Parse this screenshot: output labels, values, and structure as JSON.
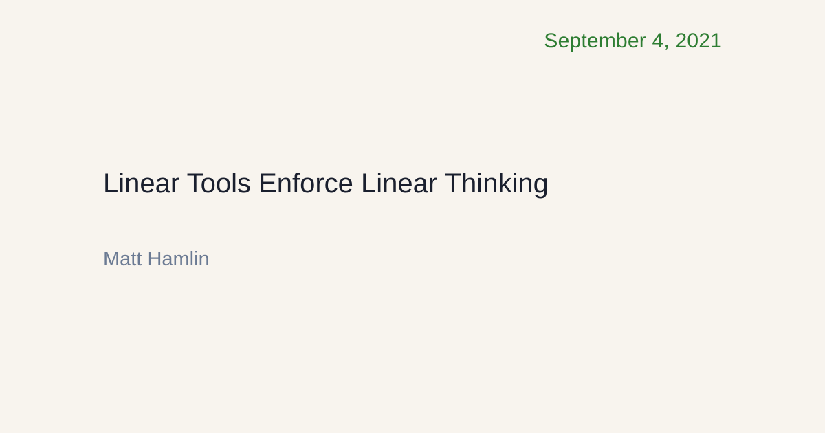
{
  "post": {
    "date": "September 4, 2021",
    "title": "Linear Tools Enforce Linear Thinking",
    "author": "Matt Hamlin"
  },
  "colors": {
    "background": "#f8f4ee",
    "date": "#2e7d32",
    "title": "#1a1f2e",
    "author": "#6b7a93"
  }
}
